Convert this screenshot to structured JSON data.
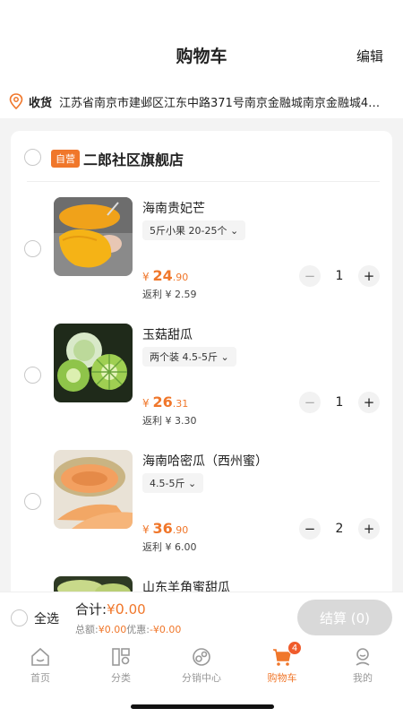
{
  "header": {
    "title": "购物车",
    "edit_label": "编辑"
  },
  "address": {
    "label": "收货",
    "value": "江苏省南京市建邺区江东中路371号南京金融城南京金融城4…"
  },
  "store": {
    "badge": "自营",
    "name": "二郎社区旗舰店"
  },
  "items": [
    {
      "name": "海南贵妃芒",
      "spec": "5斤小果 20-25个",
      "currency": "¥",
      "price_int": "24",
      "price_dec": ".90",
      "rebate": "返利 ¥ 2.59",
      "qty": "1",
      "minus_enabled": false
    },
    {
      "name": "玉菇甜瓜",
      "spec": "两个装 4.5-5斤",
      "currency": "¥",
      "price_int": "26",
      "price_dec": ".31",
      "rebate": "返利 ¥ 3.30",
      "qty": "1",
      "minus_enabled": false
    },
    {
      "name": "海南哈密瓜（西州蜜）",
      "spec": "4.5-5斤",
      "currency": "¥",
      "price_int": "36",
      "price_dec": ".90",
      "rebate": "返利 ¥ 6.00",
      "qty": "2",
      "minus_enabled": true
    },
    {
      "name": "山东羊角蜜甜瓜"
    }
  ],
  "bottom": {
    "select_all": "全选",
    "total_label": "合计:",
    "total_currency": "¥",
    "total_int": "0",
    "total_dec": ".00",
    "sum_label": "总额:",
    "sum_value": "¥0.00",
    "discount_label": "优惠:",
    "discount_value": "-¥0.00",
    "checkout_label": "结算 (0)"
  },
  "tabs": [
    {
      "label": "首页",
      "icon": "home-icon"
    },
    {
      "label": "分类",
      "icon": "category-icon"
    },
    {
      "label": "分销中心",
      "icon": "distribution-icon"
    },
    {
      "label": "购物车",
      "icon": "cart-icon",
      "badge": "4",
      "active": true
    },
    {
      "label": "我的",
      "icon": "profile-icon"
    }
  ],
  "colors": {
    "accent": "#f0772b",
    "badge": "#f05b2b",
    "checkout_disabled": "#d9d9d9"
  }
}
